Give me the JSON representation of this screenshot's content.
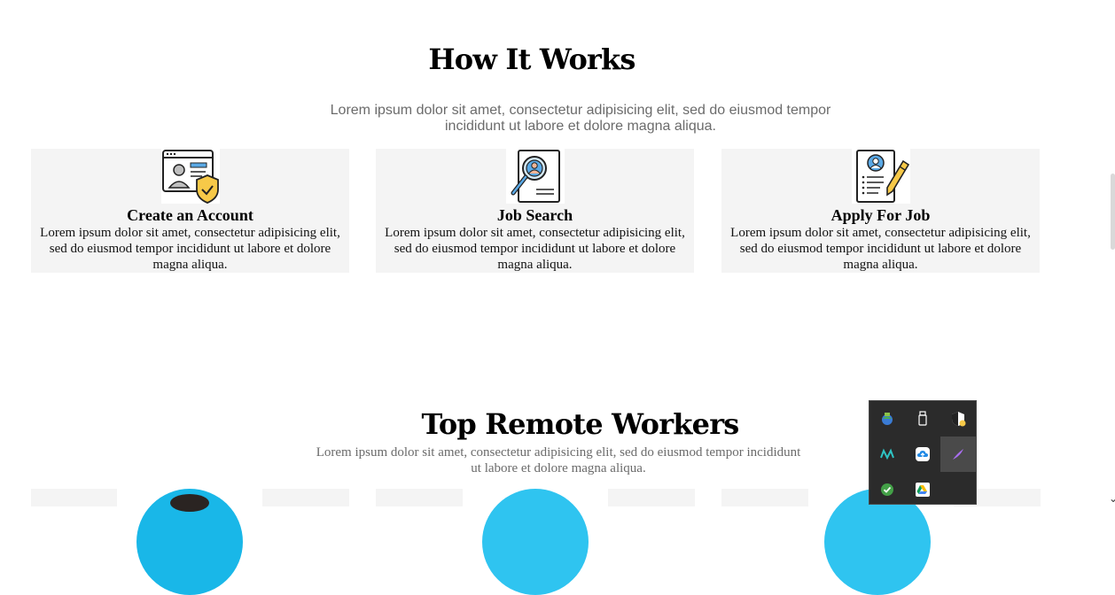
{
  "how_it_works": {
    "title": "How It Works",
    "subtitle": "Lorem ipsum dolor sit amet, consectetur adipisicing elit, sed do eiusmod tempor incididunt ut labore et dolore magna aliqua.",
    "steps": [
      {
        "icon": "account-shield-icon",
        "title": "Create an Account",
        "text": "Lorem ipsum dolor sit amet, consectetur adipisicing elit, sed do eiusmod tempor incididunt ut labore et dolore magna aliqua."
      },
      {
        "icon": "job-search-icon",
        "title": "Job Search",
        "text": "Lorem ipsum dolor sit amet, consectetur adipisicing elit, sed do eiusmod tempor incididunt ut labore et dolore magna aliqua."
      },
      {
        "icon": "application-pencil-icon",
        "title": "Apply For Job",
        "text": "Lorem ipsum dolor sit amet, consectetur adipisicing elit, sed do eiusmod tempor incididunt ut labore et dolore magna aliqua."
      }
    ]
  },
  "top_remote_workers": {
    "title": "Top Remote Workers",
    "subtitle": "Lorem ipsum dolor sit amet, consectetur adipisicing elit, sed do eiusmod tempor incididunt ut labore et dolore magna aliqua."
  },
  "system_tray": {
    "icons": [
      "network-globe-icon",
      "usb-drive-icon",
      "security-shield-icon",
      "meta-app-icon",
      "cloud-upload-icon",
      "feather-app-icon",
      "green-check-icon",
      "google-drive-icon"
    ]
  },
  "colors": {
    "card_background": "#f4f4f4",
    "subtitle_gray": "#6b6b6b",
    "avatar_blue": "#19b7e8",
    "tray_background": "#2b2b2b",
    "shield_yellow": "#f7c948",
    "icon_blue": "#5aa9e6"
  }
}
